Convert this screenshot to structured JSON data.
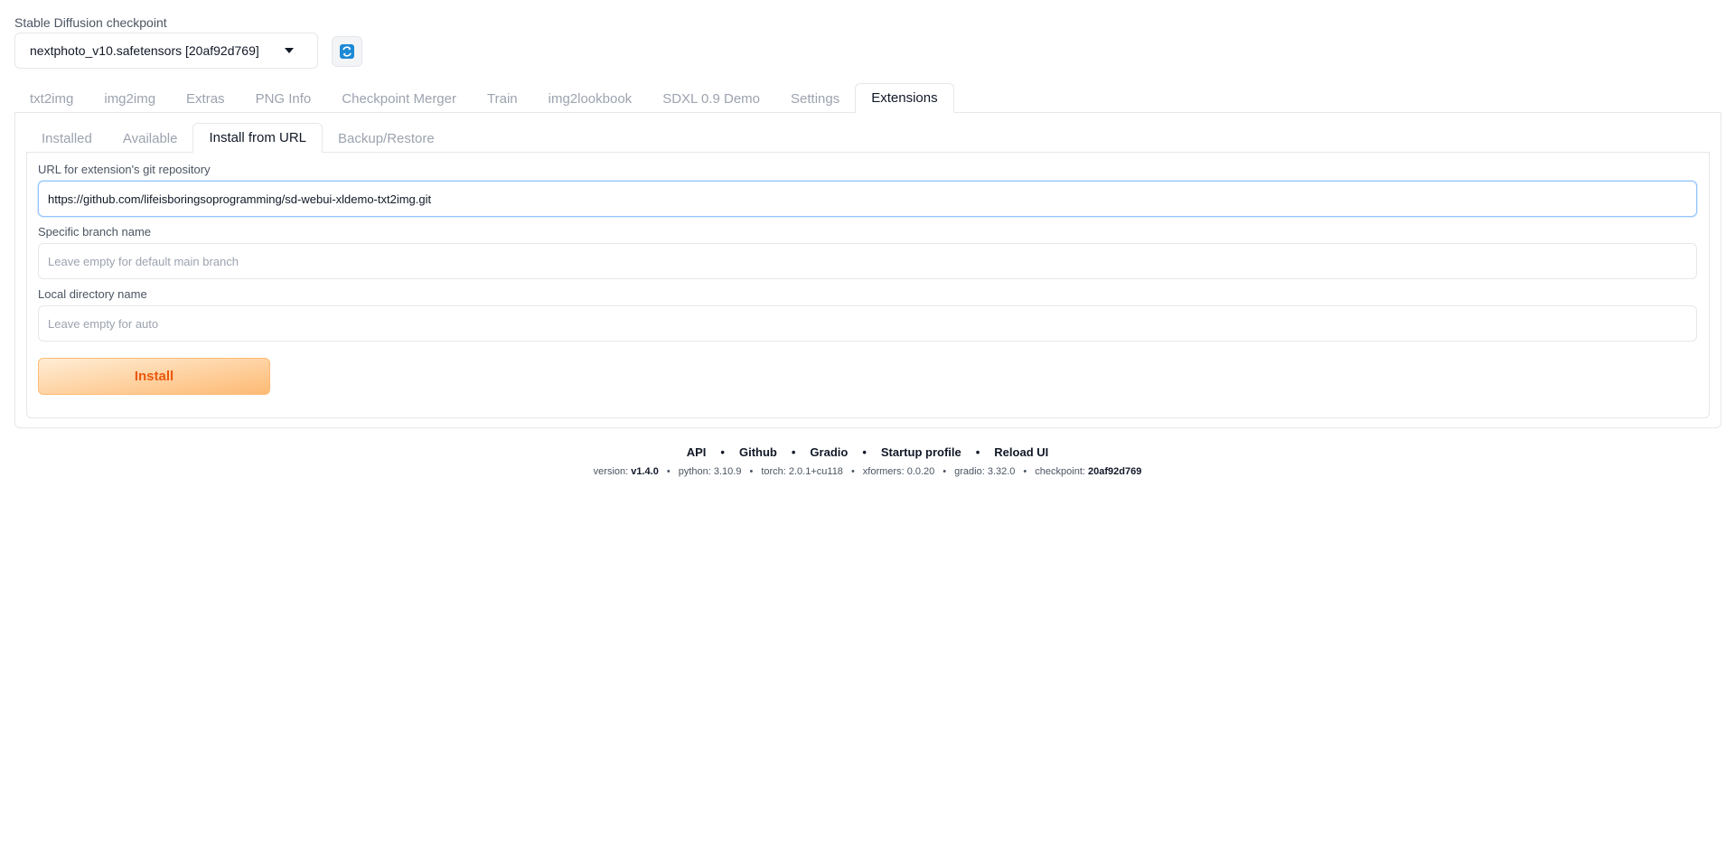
{
  "checkpoint": {
    "label": "Stable Diffusion checkpoint",
    "selected": "nextphoto_v10.safetensors [20af92d769]"
  },
  "icons": {
    "refresh": "refresh-icon",
    "dropdown": "caret-down-icon"
  },
  "main_tabs": [
    {
      "label": "txt2img"
    },
    {
      "label": "img2img"
    },
    {
      "label": "Extras"
    },
    {
      "label": "PNG Info"
    },
    {
      "label": "Checkpoint Merger"
    },
    {
      "label": "Train"
    },
    {
      "label": "img2lookbook"
    },
    {
      "label": "SDXL 0.9 Demo"
    },
    {
      "label": "Settings"
    },
    {
      "label": "Extensions"
    }
  ],
  "active_main_tab": "Extensions",
  "sub_tabs": [
    {
      "label": "Installed"
    },
    {
      "label": "Available"
    },
    {
      "label": "Install from URL"
    },
    {
      "label": "Backup/Restore"
    }
  ],
  "active_sub_tab": "Install from URL",
  "form": {
    "url_label": "URL for extension's git repository",
    "url_value": "https://github.com/lifeisboringsoprogramming/sd-webui-xldemo-txt2img.git",
    "branch_label": "Specific branch name",
    "branch_placeholder": "Leave empty for default main branch",
    "dir_label": "Local directory name",
    "dir_placeholder": "Leave empty for auto",
    "install_label": "Install"
  },
  "footer": {
    "links": [
      "API",
      "Github",
      "Gradio",
      "Startup profile",
      "Reload UI"
    ],
    "separator": "•",
    "versions": {
      "version_label": "version:",
      "version_value": "v1.4.0",
      "python": "python: 3.10.9",
      "torch": "torch: 2.0.1+cu118",
      "xformers": "xformers: 0.0.20",
      "gradio": "gradio: 3.32.0",
      "checkpoint_label": "checkpoint:",
      "checkpoint_value": "20af92d769"
    }
  },
  "colors": {
    "install_text": "#ea580c",
    "install_bg_start": "#ffedd5",
    "install_bg_end": "#fdba74",
    "refresh_icon": "#1d8ad6"
  }
}
